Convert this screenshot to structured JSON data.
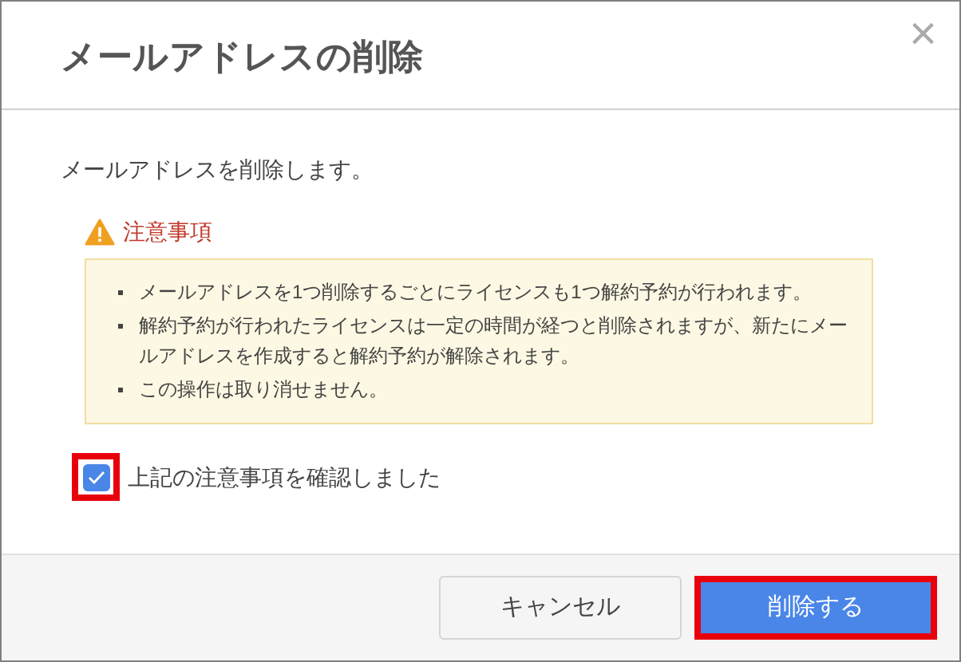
{
  "dialog": {
    "title": "メールアドレスの削除",
    "close": "×"
  },
  "message": "メールアドレスを削除します。",
  "notice": {
    "heading": "注意事項",
    "items": [
      "メールアドレスを1つ削除するごとにライセンスも1つ解約予約が行われます。",
      "解約予約が行われたライセンスは一定の時間が経つと削除されますが、新たにメールアドレスを作成すると解約予約が解除されます。",
      "この操作は取り消せません。"
    ]
  },
  "confirm": {
    "label": "上記の注意事項を確認しました",
    "checked": true,
    "highlighted": true
  },
  "buttons": [
    {
      "label": "キャンセル",
      "kind": "secondary",
      "highlighted": false
    },
    {
      "label": "削除する",
      "kind": "primary",
      "highlighted": true
    }
  ]
}
